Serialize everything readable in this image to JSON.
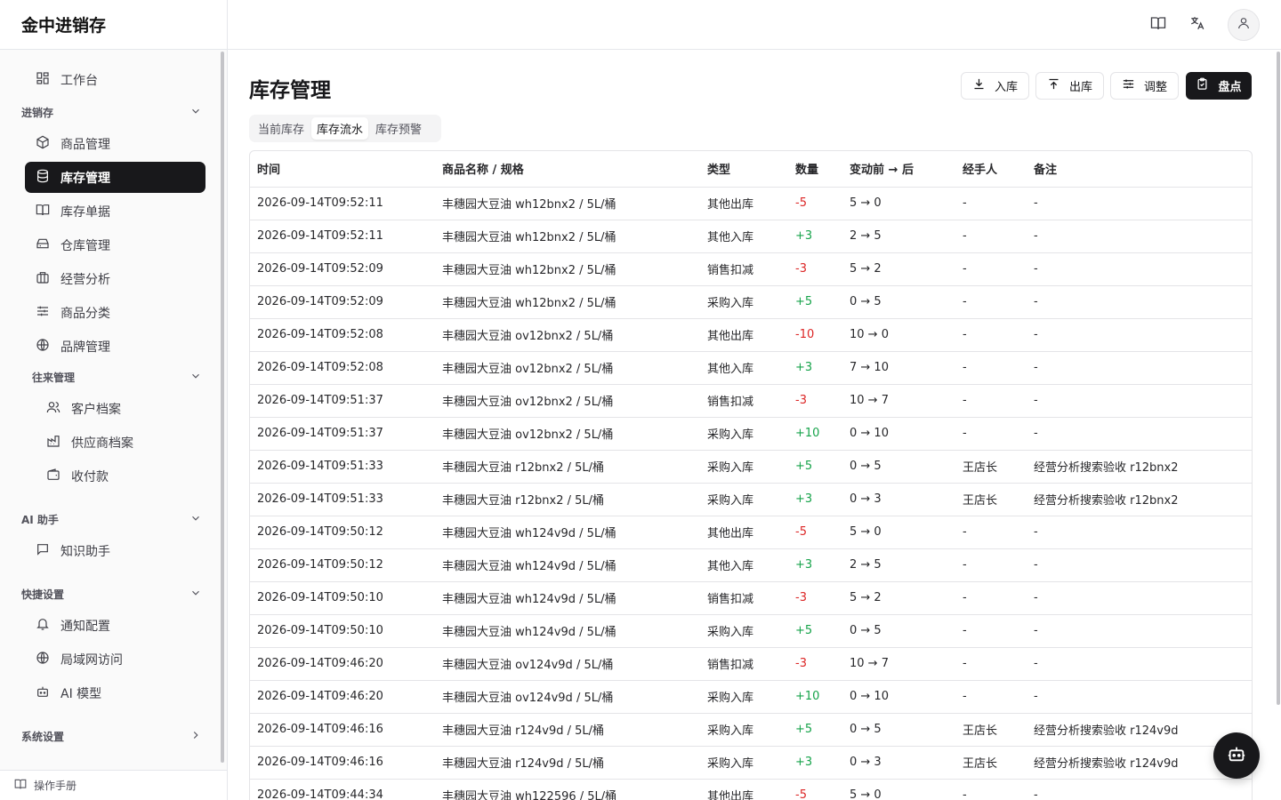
{
  "app": {
    "title": "金中进销存"
  },
  "sidebar": {
    "workbench": {
      "label": "工作台",
      "icon": "dashboard-icon"
    },
    "groups": {
      "inventory": {
        "label": "进销存",
        "items": [
          {
            "label": "商品管理",
            "icon": "package-icon"
          },
          {
            "label": "库存管理",
            "icon": "database-icon",
            "active": true
          },
          {
            "label": "库存单据",
            "icon": "book-icon"
          },
          {
            "label": "仓库管理",
            "icon": "warehouse-icon"
          },
          {
            "label": "经营分析",
            "icon": "briefcase-icon"
          },
          {
            "label": "商品分类",
            "icon": "sliders-icon"
          },
          {
            "label": "品牌管理",
            "icon": "globe-icon"
          }
        ]
      },
      "relations": {
        "label": "往来管理",
        "items": [
          {
            "label": "客户档案",
            "icon": "users-icon"
          },
          {
            "label": "供应商档案",
            "icon": "factory-icon"
          },
          {
            "label": "收付款",
            "icon": "wallet-icon"
          }
        ]
      },
      "ai": {
        "label": "AI 助手",
        "items": [
          {
            "label": "知识助手",
            "icon": "chat-icon"
          }
        ]
      },
      "shortcuts": {
        "label": "快捷设置",
        "items": [
          {
            "label": "通知配置",
            "icon": "bell-icon"
          },
          {
            "label": "局域网访问",
            "icon": "globe-icon"
          },
          {
            "label": "AI 模型",
            "icon": "bot-icon"
          }
        ]
      },
      "system": {
        "label": "系统设置"
      }
    },
    "footer": {
      "label": "操作手册"
    }
  },
  "page": {
    "title": "库存管理",
    "actions": {
      "inbound": "入库",
      "outbound": "出库",
      "adjust": "调整",
      "stocktake": "盘点"
    },
    "tabs": [
      "当前库存",
      "库存流水",
      "库存预警"
    ],
    "active_tab": "库存流水"
  },
  "table": {
    "headers": [
      "时间",
      "商品名称 / 规格",
      "类型",
      "数量",
      "变动前 → 后",
      "经手人",
      "备注"
    ],
    "rows": [
      [
        "2026-09-14T09:52:11",
        "丰穗园大豆油 wh12bnx2 / 5L/桶",
        "其他出库",
        "-5",
        "5 → 0",
        "-",
        "-"
      ],
      [
        "2026-09-14T09:52:11",
        "丰穗园大豆油 wh12bnx2 / 5L/桶",
        "其他入库",
        "+3",
        "2 → 5",
        "-",
        "-"
      ],
      [
        "2026-09-14T09:52:09",
        "丰穗园大豆油 wh12bnx2 / 5L/桶",
        "销售扣减",
        "-3",
        "5 → 2",
        "-",
        "-"
      ],
      [
        "2026-09-14T09:52:09",
        "丰穗园大豆油 wh12bnx2 / 5L/桶",
        "采购入库",
        "+5",
        "0 → 5",
        "-",
        "-"
      ],
      [
        "2026-09-14T09:52:08",
        "丰穗园大豆油 ov12bnx2 / 5L/桶",
        "其他出库",
        "-10",
        "10 → 0",
        "-",
        "-"
      ],
      [
        "2026-09-14T09:52:08",
        "丰穗园大豆油 ov12bnx2 / 5L/桶",
        "其他入库",
        "+3",
        "7 → 10",
        "-",
        "-"
      ],
      [
        "2026-09-14T09:51:37",
        "丰穗园大豆油 ov12bnx2 / 5L/桶",
        "销售扣减",
        "-3",
        "10 → 7",
        "-",
        "-"
      ],
      [
        "2026-09-14T09:51:37",
        "丰穗园大豆油 ov12bnx2 / 5L/桶",
        "采购入库",
        "+10",
        "0 → 10",
        "-",
        "-"
      ],
      [
        "2026-09-14T09:51:33",
        "丰穗园大豆油 r12bnx2 / 5L/桶",
        "采购入库",
        "+5",
        "0 → 5",
        "王店长",
        "经营分析搜索验收 r12bnx2"
      ],
      [
        "2026-09-14T09:51:33",
        "丰穗园大豆油 r12bnx2 / 5L/桶",
        "采购入库",
        "+3",
        "0 → 3",
        "王店长",
        "经营分析搜索验收 r12bnx2"
      ],
      [
        "2026-09-14T09:50:12",
        "丰穗园大豆油 wh124v9d / 5L/桶",
        "其他出库",
        "-5",
        "5 → 0",
        "-",
        "-"
      ],
      [
        "2026-09-14T09:50:12",
        "丰穗园大豆油 wh124v9d / 5L/桶",
        "其他入库",
        "+3",
        "2 → 5",
        "-",
        "-"
      ],
      [
        "2026-09-14T09:50:10",
        "丰穗园大豆油 wh124v9d / 5L/桶",
        "销售扣减",
        "-3",
        "5 → 2",
        "-",
        "-"
      ],
      [
        "2026-09-14T09:50:10",
        "丰穗园大豆油 wh124v9d / 5L/桶",
        "采购入库",
        "+5",
        "0 → 5",
        "-",
        "-"
      ],
      [
        "2026-09-14T09:46:20",
        "丰穗园大豆油 ov124v9d / 5L/桶",
        "销售扣减",
        "-3",
        "10 → 7",
        "-",
        "-"
      ],
      [
        "2026-09-14T09:46:20",
        "丰穗园大豆油 ov124v9d / 5L/桶",
        "采购入库",
        "+10",
        "0 → 10",
        "-",
        "-"
      ],
      [
        "2026-09-14T09:46:16",
        "丰穗园大豆油 r124v9d / 5L/桶",
        "采购入库",
        "+5",
        "0 → 5",
        "王店长",
        "经营分析搜索验收 r124v9d"
      ],
      [
        "2026-09-14T09:46:16",
        "丰穗园大豆油 r124v9d / 5L/桶",
        "采购入库",
        "+3",
        "0 → 3",
        "王店长",
        "经营分析搜索验收 r124v9d"
      ],
      [
        "2026-09-14T09:44:34",
        "丰穗园大豆油 wh122596 / 5L/桶",
        "其他出库",
        "-5",
        "5 → 0",
        "-",
        "-"
      ]
    ]
  },
  "colors": {
    "positive": "#16a34a",
    "negative": "#dc2626",
    "primary": "#18181b"
  }
}
